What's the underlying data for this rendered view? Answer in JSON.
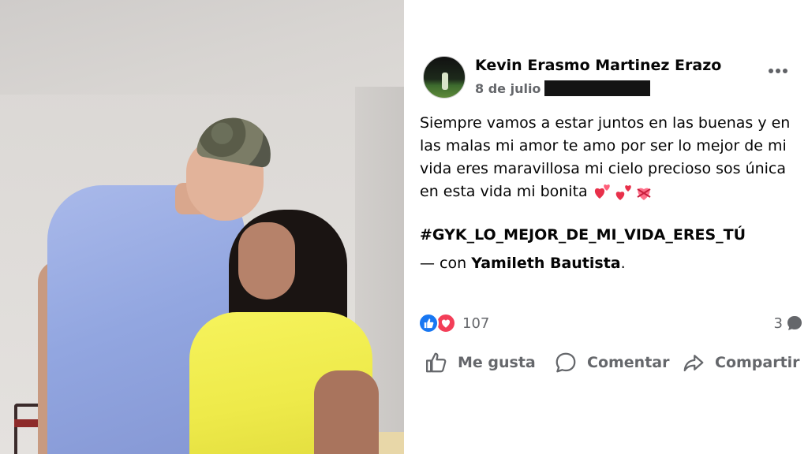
{
  "post": {
    "author": "Kevin Erasmo Martinez Erazo",
    "date": "8 de julio",
    "text": "Siempre vamos a estar juntos en las buenas y en las malas mi amor te amo por ser lo mejor de mi vida eres maravillosa mi cielo precioso sos única en esta vida mi bonita",
    "emoji_icons": [
      "two-hearts-icon",
      "hearts-icon",
      "heart-with-ribbon-icon"
    ],
    "hashtag": "#GYK_LO_MEJOR_DE_MI_VIDA_ERES_TÚ",
    "tag_prefix": "— con",
    "tagged_person": "Yamileth Bautista",
    "tag_suffix": "."
  },
  "reactions": {
    "icons": [
      "like-reaction-icon",
      "love-reaction-icon"
    ],
    "count": "107",
    "comment_count": "3"
  },
  "actions": {
    "like": "Me gusta",
    "comment": "Comentar",
    "share": "Compartir"
  },
  "colors": {
    "like_blue": "#1877f2",
    "love_red": "#f33e58",
    "secondary_text": "#65676b",
    "primary_text": "#050505"
  }
}
